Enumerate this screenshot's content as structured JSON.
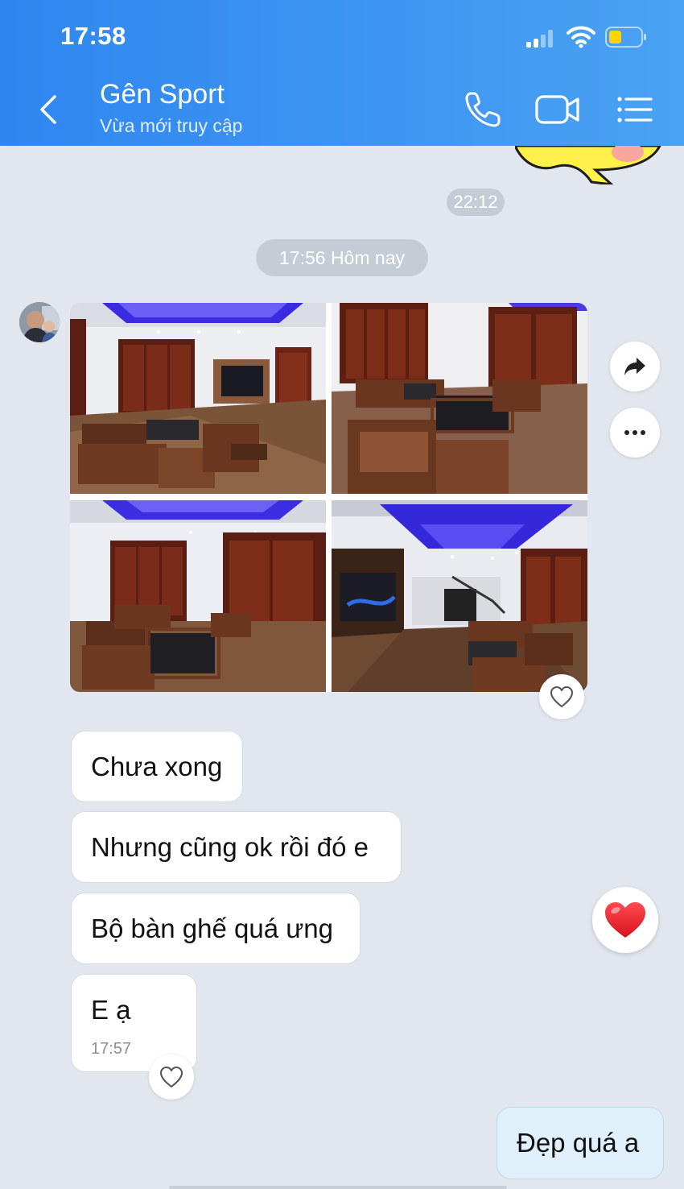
{
  "status_bar": {
    "time": "17:58"
  },
  "header": {
    "contact_name": "Gên Sport",
    "contact_status": "Vừa mới truy cập",
    "icons": [
      "back-icon",
      "phone-icon",
      "video-icon",
      "menu-icon"
    ]
  },
  "timestamps": {
    "previous": "22:12",
    "today": "17:56 Hôm nay"
  },
  "photos": [
    "living-room-photo-1",
    "living-room-photo-2",
    "living-room-photo-3",
    "living-room-photo-4"
  ],
  "messages": [
    {
      "text": "Chưa xong"
    },
    {
      "text": "Nhưng cũng ok rồi đó e"
    },
    {
      "text": "Bộ bàn ghế quá ưng"
    },
    {
      "text": "E ạ",
      "time": "17:57"
    }
  ],
  "outgoing": {
    "text": "Đẹp quá a"
  },
  "colors": {
    "header_start": "#2f86ef",
    "header_end": "#4aa2f4",
    "background": "#e2e7ef",
    "outgoing_bubble": "#dff0fb",
    "reaction_heart": "#e8232e"
  }
}
